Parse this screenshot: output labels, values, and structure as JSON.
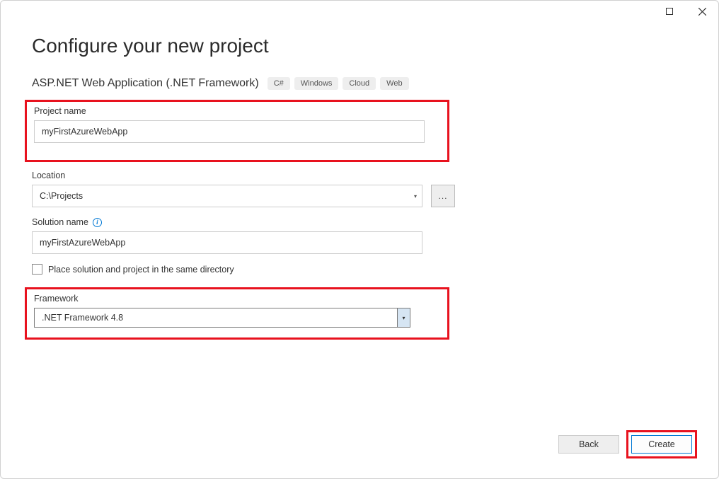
{
  "window": {
    "title": "Configure your new project",
    "subtitle": "ASP.NET Web Application (.NET Framework)",
    "tags": [
      "C#",
      "Windows",
      "Cloud",
      "Web"
    ]
  },
  "fields": {
    "projectName": {
      "label": "Project name",
      "value": "myFirstAzureWebApp"
    },
    "location": {
      "label": "Location",
      "value": "C:\\Projects",
      "browse": "..."
    },
    "solutionName": {
      "label": "Solution name",
      "value": "myFirstAzureWebApp"
    },
    "sameDirCheckbox": {
      "label": "Place solution and project in the same directory",
      "checked": false
    },
    "framework": {
      "label": "Framework",
      "value": ".NET Framework 4.8"
    }
  },
  "footer": {
    "back": "Back",
    "create": "Create"
  }
}
